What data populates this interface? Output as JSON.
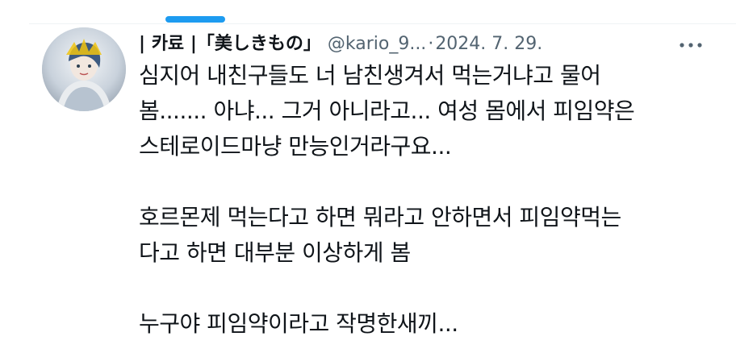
{
  "colors": {
    "accent": "#1d9bf0",
    "text_primary": "#0f1419",
    "text_secondary": "#536471"
  },
  "tweet": {
    "avatar_icon": "profile-avatar-icon",
    "display_name": "| 카료 |「美しきもの」",
    "handle": "@kario_9...",
    "separator": "·",
    "date": "2024. 7. 29.",
    "more_icon": "more-horizontal-icon",
    "paragraphs": [
      [
        "심지어 내친구들도 너 남친생겨서 먹는거냐고 물어",
        "봄....... 아냐... 그거 아니라고... 여성 몸에서  피임약은",
        "스테로이드마냥 만능인거라구요..."
      ],
      [
        "호르몬제 먹는다고 하면 뭐라고 안하면서 피임약먹는",
        "다고 하면 대부분 이상하게 봄"
      ],
      [
        "누구야 피임약이라고 작명한새끼..."
      ]
    ]
  }
}
